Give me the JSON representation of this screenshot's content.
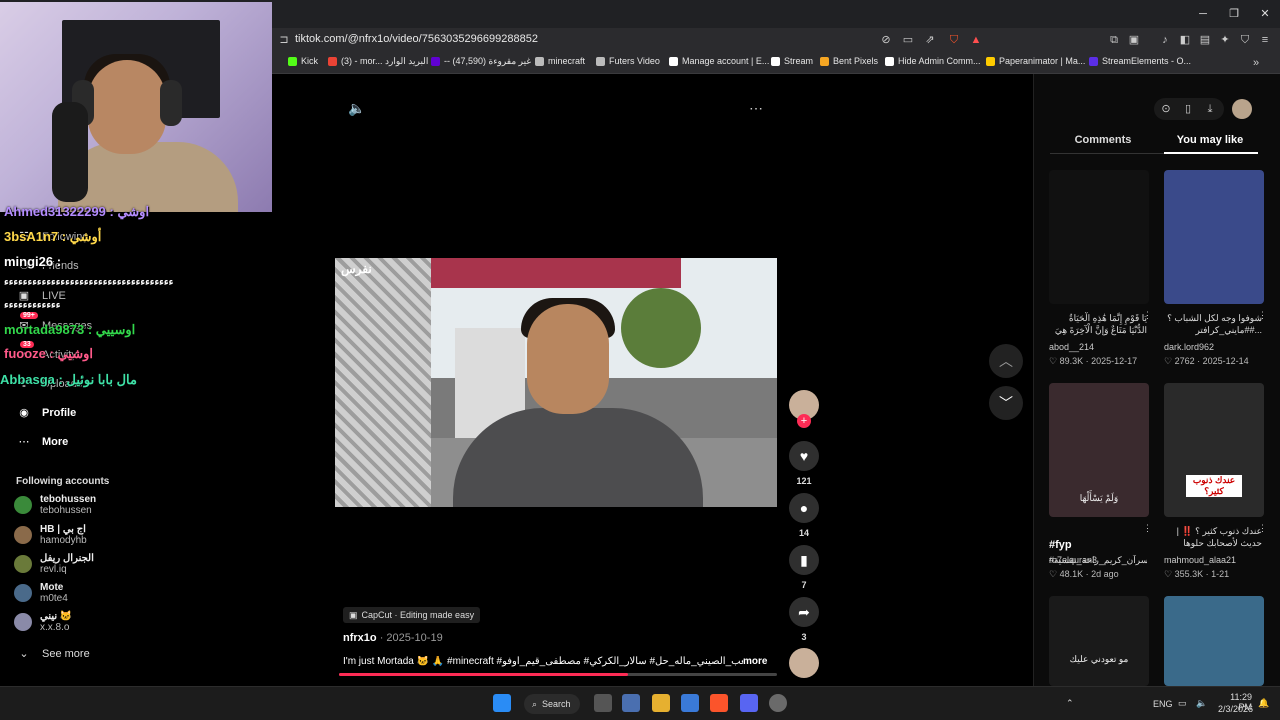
{
  "browser": {
    "url": "tiktok.com/@nfrx1o/video/7563035296699288852",
    "bookmarks": [
      {
        "label": "Kick",
        "color": "#53fc18"
      },
      {
        "label": "(3) - mor... البريد الوارد",
        "color": "#ea4335"
      },
      {
        "label": "-- غير مقروءة (47,590)",
        "color": "#6001d2"
      },
      {
        "label": "minecraft",
        "color": "#bbbbbb"
      },
      {
        "label": "Futers Video",
        "color": "#bbbbbb"
      },
      {
        "label": "Manage account | E...",
        "color": "#ffffff"
      },
      {
        "label": "Stream",
        "color": "#ffffff"
      },
      {
        "label": "Bent Pixels",
        "color": "#f5a623"
      },
      {
        "label": "Hide Admin Comm...",
        "color": "#ffffff"
      },
      {
        "label": "Paperanimator | Ma...",
        "color": "#ffcc00"
      },
      {
        "label": "StreamElements - O...",
        "color": "#5b2ee6"
      }
    ]
  },
  "overlay_chat": [
    {
      "text": "Ahmed31322299 : اوشي",
      "color": "#b48cff"
    },
    {
      "text": "3bsA1n7 : أوشي",
      "color": "#ffd84a"
    },
    {
      "text": "mingi26 :",
      "color": "#ffffff"
    },
    {
      "text": "ﺀﺀﺀﺀﺀﺀﺀﺀﺀﺀﺀﺀﺀﺀﺀﺀﺀﺀﺀﺀﺀﺀﺀﺀﺀﺀﺀﺀﺀﺀﺀﺀﺀﺀﺀﺀ",
      "color": "#ffffff"
    },
    {
      "text": "ﺀﺀﺀﺀﺀﺀﺀﺀﺀﺀﺀﺀ",
      "color": "#ffffff"
    },
    {
      "text": "mortada9873 : اوسييي",
      "color": "#32d74b"
    },
    {
      "text": "fuooze : اوشيي",
      "color": "#ff5a8a"
    },
    {
      "text": "Abbasga : مال بابا نوئيل",
      "color": "#3ee0a6"
    }
  ],
  "sidebar": {
    "nav": [
      {
        "label": "Following",
        "icon": "following-icon"
      },
      {
        "label": "Friends",
        "icon": "friends-icon"
      },
      {
        "label": "LIVE",
        "icon": "live-icon"
      },
      {
        "label": "Messages",
        "icon": "messages-icon",
        "badge": "99+"
      },
      {
        "label": "Activity",
        "icon": "activity-icon",
        "badge": "33"
      },
      {
        "label": "Uploads",
        "icon": "upload-icon"
      },
      {
        "label": "Profile",
        "icon": "profile-icon"
      },
      {
        "label": "More",
        "icon": "more-icon"
      }
    ],
    "following_title": "Following accounts",
    "accounts": [
      {
        "name": "tebohussen",
        "user": "tebohussen",
        "color": "#3a8a3a"
      },
      {
        "name": "HB | اج بي",
        "user": "hamodyhb",
        "color": "#8a6a4a"
      },
      {
        "name": "الجنرال ريفل",
        "user": "revl.iq",
        "color": "#6a7a3a"
      },
      {
        "name": "Mote",
        "user": "m0te4",
        "color": "#4a6a8a"
      },
      {
        "name": "نيني 🐱",
        "user": "x.x.8.o",
        "color": "#8a8aa8"
      }
    ],
    "see_more": "See more"
  },
  "video": {
    "watermark": "نفرس",
    "capcut_label": "CapCut · Editing made easy",
    "author": "nfrx1o",
    "date": "2025-10-19",
    "caption": "I'm just Mortada 🐱 🙏 #minecraft #شعب_الصيني_ماله_حل# سالار_الكركي# مصطفى_قيم_اوفو",
    "more_label": "more",
    "progress": 0.66
  },
  "actions": {
    "likes": "121",
    "comments": "14",
    "saves": "7",
    "shares": "3"
  },
  "right_panel": {
    "tabs": [
      "Comments",
      "You may like"
    ],
    "active_tab": 1,
    "cards": [
      {
        "tag": "",
        "caption": "يَا قَوْمِ إِنَّمَا هَٰذِهِ الْحَيَاةُ الدُّنْيَا مَتَاعٌ وَإِنَّ الْآخِرَةَ هِيَ دَارُ...",
        "user": "abod__214",
        "likes": "89.3K",
        "date": "2025-12-17",
        "thumb": "#111111"
      },
      {
        "tag": "",
        "caption": "شوفوا وجه لكل الشباب ؟ #مايني_كرافتر#...",
        "user": "dark.lord962",
        "likes": "2762",
        "date": "2025-12-14",
        "thumb": "#3a4a8a"
      },
      {
        "tag": "#fyp",
        "caption": "#سرآن_كريم_راحة_نفسية#",
        "user": "ro7elquran3",
        "likes": "48.1K",
        "date": "2d ago",
        "thumb": "#3a2a2e",
        "overlay": "وَلَمْ يَسْأَلْهَا"
      },
      {
        "tag": "",
        "caption": "عندك ذنوب كثير ؟ ‼️ | حديث لأصحابك حلوها حصله",
        "user": "mahmoud_alaa21",
        "likes": "355.3K",
        "date": "1-21",
        "thumb": "#2a2a2a",
        "overlay": "عندك ذنوب كثير؟"
      },
      {
        "tag": "",
        "caption": "",
        "user": "",
        "likes": "",
        "date": "",
        "thumb": "#1a1a1a",
        "overlay": "مو تعودني عليك"
      },
      {
        "tag": "",
        "caption": "",
        "user": "",
        "likes": "",
        "date": "",
        "thumb": "#3a6a8a"
      }
    ]
  },
  "taskbar": {
    "search_label": "Search",
    "lang": "ENG",
    "time": "11:29 PM",
    "date": "2/3/2026"
  }
}
